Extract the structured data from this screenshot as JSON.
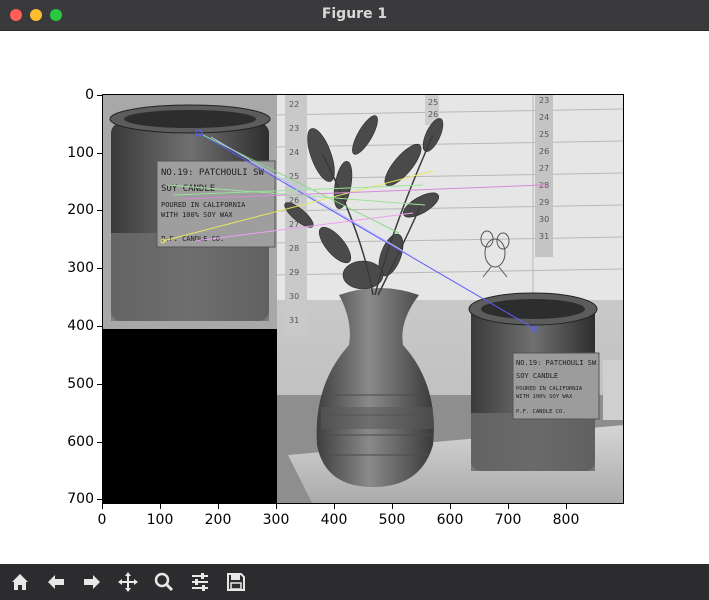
{
  "window": {
    "title": "Figure 1",
    "controls": [
      "close",
      "minimize",
      "zoom"
    ]
  },
  "axes": {
    "x_ticks": [
      "0",
      "100",
      "200",
      "300",
      "400",
      "500",
      "600",
      "700",
      "800"
    ],
    "y_ticks": [
      "0",
      "100",
      "200",
      "300",
      "400",
      "500",
      "600",
      "700"
    ]
  },
  "image": {
    "left_label_lines": [
      "NO.19: PATCHOULI SW",
      "SOY CANDLE",
      "POURED IN CALIFORNIA",
      "WITH 100% SOY WAX",
      "P.F. CANDLE CO."
    ],
    "right_label_lines": [
      "NO.19: PATCHOULI SW",
      "SOY CANDLE",
      "POURED IN CALIFORNIA",
      "WITH 100% SOY WAX",
      "P.F. CANDLE CO."
    ],
    "calendar_left": [
      "22",
      "23",
      "24",
      "25",
      "26",
      "27",
      "28",
      "29",
      "30",
      "31"
    ],
    "calendar_right": [
      "23",
      "24",
      "25",
      "26",
      "27",
      "28",
      "29",
      "30",
      "31"
    ],
    "calendar_top": [
      "25",
      "26"
    ],
    "match_colors": [
      "#5b5bff",
      "#7fd97f",
      "#e8e860",
      "#d68ad6",
      "#c0c0ff",
      "#9be29b",
      "#f0a0f0",
      "#a0e0a0"
    ]
  },
  "toolbar": {
    "buttons": [
      "home-icon",
      "back-arrow-icon",
      "forward-arrow-icon",
      "pan-icon",
      "zoom-icon",
      "configure-subplots-icon",
      "save-icon"
    ]
  }
}
